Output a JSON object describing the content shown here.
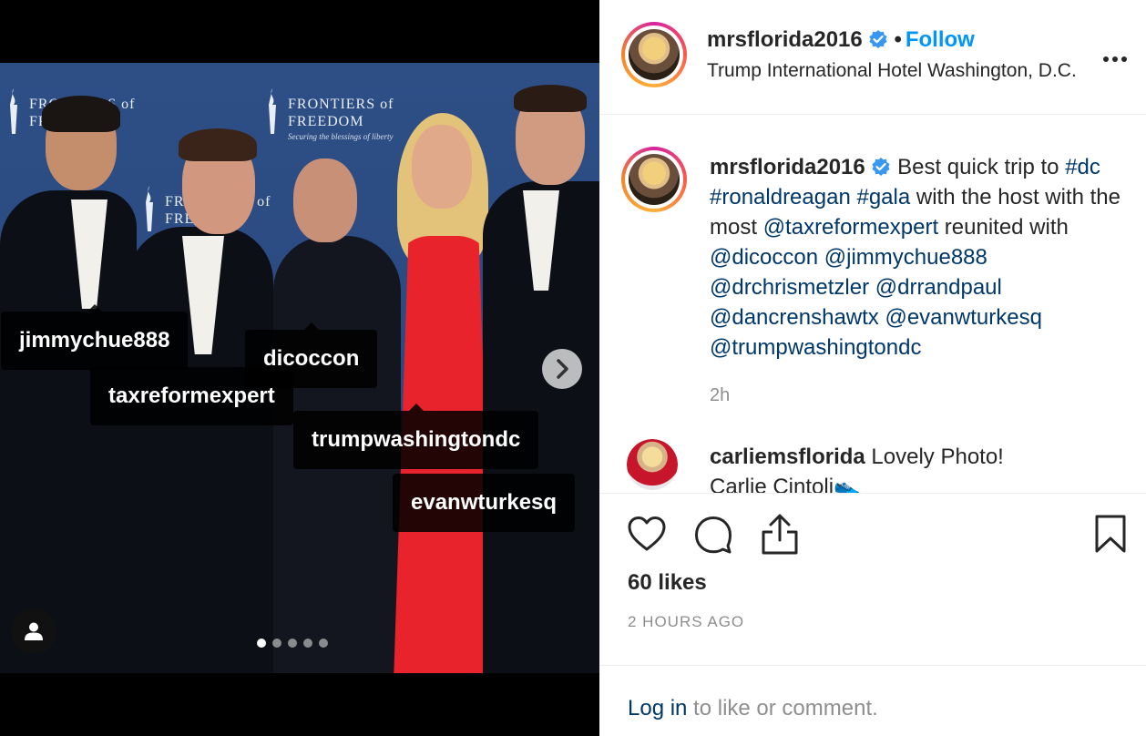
{
  "post": {
    "tags": [
      {
        "label": "jimmychue888"
      },
      {
        "label": "dicoccon"
      },
      {
        "label": "taxreformexpert"
      },
      {
        "label": "trumpwashingtondc"
      },
      {
        "label": "evanwturkesq"
      }
    ],
    "backdrop_logo": {
      "name_line1": "FRONTIERS of",
      "name_line2": "FREEDOM",
      "tagline": "Securing the blessings of liberty"
    },
    "carousel": {
      "count": 5,
      "active_index": 0
    },
    "next_glyph": "›"
  },
  "header": {
    "username": "mrsflorida2016",
    "separator": "•",
    "follow_label": "Follow",
    "location": "Trump International Hotel Washington, D.C.",
    "more_glyph": "•••"
  },
  "caption": {
    "username": "mrsflorida2016",
    "text_1": " Best quick trip to ",
    "hashtags": [
      "#dc",
      "#ronaldreagan",
      "#gala"
    ],
    "text_2": " with the host with the most ",
    "mention_1": "@taxreformexpert",
    "text_3": " reunited with ",
    "mentions": [
      "@dicoccon",
      "@jimmychue888",
      "@drchrismetzler",
      "@drrandpaul",
      "@dancrenshawtx",
      "@evanwturkesq",
      "@trumpwashingtondc"
    ],
    "time": "2h"
  },
  "comment": {
    "username": "carliemsflorida",
    "text": " Lovely Photo!",
    "text_2": "Carlie Cintoli👟"
  },
  "actions": {
    "likes": "60 likes",
    "timestamp": "2 HOURS AGO",
    "login_link": "Log in",
    "login_rest": " to like or comment."
  },
  "colors": {
    "accent": "#0095f6",
    "link": "#00376b",
    "muted": "#8e8e8e",
    "verified": "#3897f0"
  },
  "icons": [
    "heart-icon",
    "comment-icon",
    "share-icon",
    "bookmark-icon",
    "user-tag-icon",
    "chevron-right-icon",
    "verified-badge-icon",
    "more-icon"
  ]
}
